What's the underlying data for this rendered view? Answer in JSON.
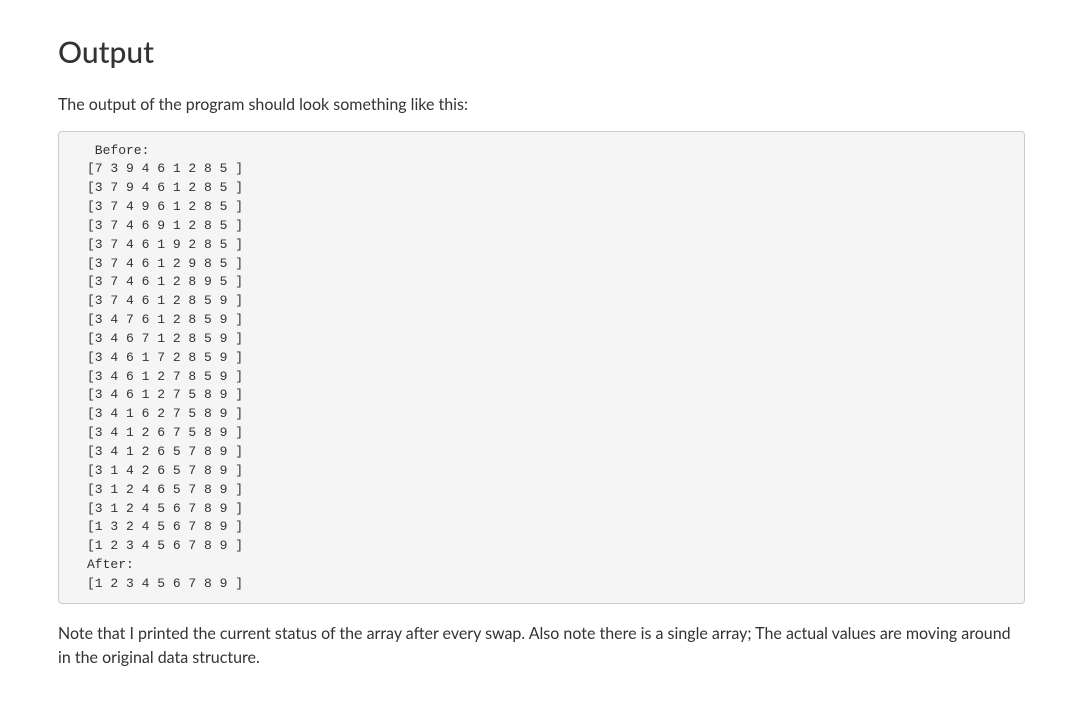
{
  "heading": "Output",
  "intro_text": "The output of the program should look something like this:",
  "code_output": " Before:\n[7 3 9 4 6 1 2 8 5 ]\n[3 7 9 4 6 1 2 8 5 ]\n[3 7 4 9 6 1 2 8 5 ]\n[3 7 4 6 9 1 2 8 5 ]\n[3 7 4 6 1 9 2 8 5 ]\n[3 7 4 6 1 2 9 8 5 ]\n[3 7 4 6 1 2 8 9 5 ]\n[3 7 4 6 1 2 8 5 9 ]\n[3 4 7 6 1 2 8 5 9 ]\n[3 4 6 7 1 2 8 5 9 ]\n[3 4 6 1 7 2 8 5 9 ]\n[3 4 6 1 2 7 8 5 9 ]\n[3 4 6 1 2 7 5 8 9 ]\n[3 4 1 6 2 7 5 8 9 ]\n[3 4 1 2 6 7 5 8 9 ]\n[3 4 1 2 6 5 7 8 9 ]\n[3 1 4 2 6 5 7 8 9 ]\n[3 1 2 4 6 5 7 8 9 ]\n[3 1 2 4 5 6 7 8 9 ]\n[1 3 2 4 5 6 7 8 9 ]\n[1 2 3 4 5 6 7 8 9 ]\nAfter:\n[1 2 3 4 5 6 7 8 9 ]",
  "note_text": "Note that I printed the current status of the array after every swap. Also note there is a single array; The actual values are moving around in the original data structure."
}
